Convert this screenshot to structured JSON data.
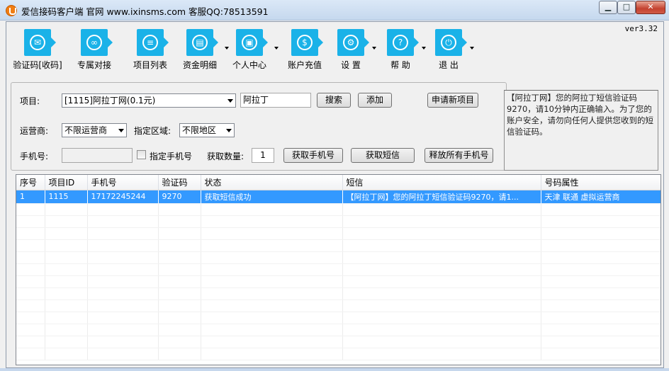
{
  "window": {
    "title": "爱信接码客户端  官网 www.ixinsms.com   客服QQ:78513591",
    "minimize": "▁",
    "maximize": "□",
    "close": "✕"
  },
  "version": "ver3.32",
  "toolbar": [
    {
      "label": "验证码[收码]",
      "icon": "sms-icon",
      "glyph": "✉",
      "dropdown": false
    },
    {
      "label": "专属对接",
      "icon": "link-icon",
      "glyph": "∞",
      "dropdown": false
    },
    {
      "label": "项目列表",
      "icon": "list-icon",
      "glyph": "≡",
      "dropdown": false
    },
    {
      "label": "资金明细",
      "icon": "ledger-icon",
      "glyph": "▤",
      "dropdown": true
    },
    {
      "label": "个人中心",
      "icon": "id-card-icon",
      "glyph": "▣",
      "dropdown": true
    },
    {
      "label": "账户充值",
      "icon": "money-bag-icon",
      "glyph": "$",
      "dropdown": false
    },
    {
      "label": "设 置",
      "icon": "gear-icon",
      "glyph": "⚙",
      "dropdown": true
    },
    {
      "label": "帮 助",
      "icon": "help-icon",
      "glyph": "?",
      "dropdown": true
    },
    {
      "label": "退 出",
      "icon": "power-icon",
      "glyph": "⏻",
      "dropdown": true
    }
  ],
  "form": {
    "project_label": "项目:",
    "project_value": "[1115]阿拉丁网(0.1元)",
    "search_value": "阿拉丁",
    "search_button": "搜索",
    "add_button": "添加",
    "apply_button": "申请新项目",
    "carrier_label": "运营商:",
    "carrier_value": "不限运营商",
    "region_label": "指定区域:",
    "region_value": "不限地区",
    "phone_label": "手机号:",
    "phone_value": "",
    "specify_phone_label": "指定手机号",
    "specify_phone_checked": false,
    "quantity_label": "获取数量:",
    "quantity_value": "1",
    "get_phone_button": "获取手机号",
    "get_sms_button": "获取短信",
    "release_button": "释放所有手机号"
  },
  "info_message": "【阿拉丁网】您的阿拉丁短信验证码9270，请10分钟内正确输入。为了您的账户安全，请勿向任何人提供您收到的短信验证码。",
  "table": {
    "columns": [
      "序号",
      "项目ID",
      "手机号",
      "验证码",
      "状态",
      "短信",
      "号码属性"
    ],
    "rows": [
      {
        "index": "1",
        "project_id": "1115",
        "phone": "17172245244",
        "code": "9270",
        "status": "获取短信成功",
        "sms": "【阿拉丁网】您的阿拉丁短信验证码9270，请1...",
        "attr": "天津 联通 虚拟运营商",
        "selected": true
      }
    ]
  }
}
